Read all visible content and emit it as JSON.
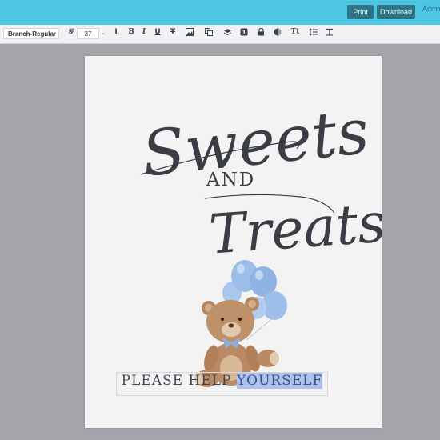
{
  "header": {
    "print_label": "Print",
    "download_label": "Download",
    "admin_label": "Admin"
  },
  "toolbar": {
    "font_name": "Branch-Regular",
    "font_size": "37",
    "icons": [
      "font-style-icon",
      "line-height-icon",
      "bold-icon",
      "italic-icon",
      "underline-icon",
      "strikethrough-icon",
      "image-icon",
      "copy-icon",
      "layers-icon",
      "lock-icon",
      "effects-icon",
      "text-size-icon",
      "list-icon",
      "clear-format-icon"
    ]
  },
  "design": {
    "title_line1": "Sweets",
    "and_text": "AND",
    "title_line2": "Treats",
    "tagline_before": "PLEASE HELP ",
    "tagline_selected": "YOURSELF",
    "balloon_color": "#9bbde8",
    "text_color": "#3f4654",
    "selection_color": "#aac2ec"
  },
  "colors": {
    "header_bg": "#4dc6e4",
    "button_bg": "#2d7584",
    "canvas_bg": "#a3a5aa"
  }
}
